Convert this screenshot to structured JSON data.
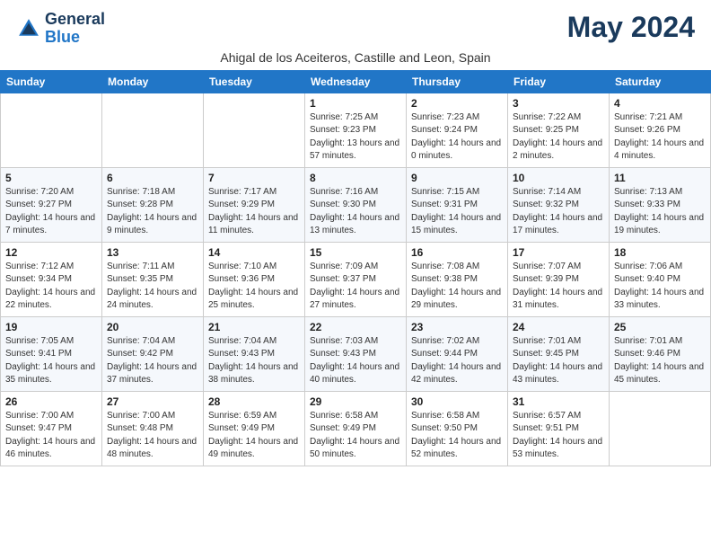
{
  "header": {
    "logo_line1": "General",
    "logo_line2": "Blue",
    "month": "May 2024",
    "subtitle": "Ahigal de los Aceiteros, Castille and Leon, Spain"
  },
  "days_of_week": [
    "Sunday",
    "Monday",
    "Tuesday",
    "Wednesday",
    "Thursday",
    "Friday",
    "Saturday"
  ],
  "weeks": [
    [
      {
        "day": "",
        "info": ""
      },
      {
        "day": "",
        "info": ""
      },
      {
        "day": "",
        "info": ""
      },
      {
        "day": "1",
        "info": "Sunrise: 7:25 AM\nSunset: 9:23 PM\nDaylight: 13 hours and 57 minutes."
      },
      {
        "day": "2",
        "info": "Sunrise: 7:23 AM\nSunset: 9:24 PM\nDaylight: 14 hours and 0 minutes."
      },
      {
        "day": "3",
        "info": "Sunrise: 7:22 AM\nSunset: 9:25 PM\nDaylight: 14 hours and 2 minutes."
      },
      {
        "day": "4",
        "info": "Sunrise: 7:21 AM\nSunset: 9:26 PM\nDaylight: 14 hours and 4 minutes."
      }
    ],
    [
      {
        "day": "5",
        "info": "Sunrise: 7:20 AM\nSunset: 9:27 PM\nDaylight: 14 hours and 7 minutes."
      },
      {
        "day": "6",
        "info": "Sunrise: 7:18 AM\nSunset: 9:28 PM\nDaylight: 14 hours and 9 minutes."
      },
      {
        "day": "7",
        "info": "Sunrise: 7:17 AM\nSunset: 9:29 PM\nDaylight: 14 hours and 11 minutes."
      },
      {
        "day": "8",
        "info": "Sunrise: 7:16 AM\nSunset: 9:30 PM\nDaylight: 14 hours and 13 minutes."
      },
      {
        "day": "9",
        "info": "Sunrise: 7:15 AM\nSunset: 9:31 PM\nDaylight: 14 hours and 15 minutes."
      },
      {
        "day": "10",
        "info": "Sunrise: 7:14 AM\nSunset: 9:32 PM\nDaylight: 14 hours and 17 minutes."
      },
      {
        "day": "11",
        "info": "Sunrise: 7:13 AM\nSunset: 9:33 PM\nDaylight: 14 hours and 19 minutes."
      }
    ],
    [
      {
        "day": "12",
        "info": "Sunrise: 7:12 AM\nSunset: 9:34 PM\nDaylight: 14 hours and 22 minutes."
      },
      {
        "day": "13",
        "info": "Sunrise: 7:11 AM\nSunset: 9:35 PM\nDaylight: 14 hours and 24 minutes."
      },
      {
        "day": "14",
        "info": "Sunrise: 7:10 AM\nSunset: 9:36 PM\nDaylight: 14 hours and 25 minutes."
      },
      {
        "day": "15",
        "info": "Sunrise: 7:09 AM\nSunset: 9:37 PM\nDaylight: 14 hours and 27 minutes."
      },
      {
        "day": "16",
        "info": "Sunrise: 7:08 AM\nSunset: 9:38 PM\nDaylight: 14 hours and 29 minutes."
      },
      {
        "day": "17",
        "info": "Sunrise: 7:07 AM\nSunset: 9:39 PM\nDaylight: 14 hours and 31 minutes."
      },
      {
        "day": "18",
        "info": "Sunrise: 7:06 AM\nSunset: 9:40 PM\nDaylight: 14 hours and 33 minutes."
      }
    ],
    [
      {
        "day": "19",
        "info": "Sunrise: 7:05 AM\nSunset: 9:41 PM\nDaylight: 14 hours and 35 minutes."
      },
      {
        "day": "20",
        "info": "Sunrise: 7:04 AM\nSunset: 9:42 PM\nDaylight: 14 hours and 37 minutes."
      },
      {
        "day": "21",
        "info": "Sunrise: 7:04 AM\nSunset: 9:43 PM\nDaylight: 14 hours and 38 minutes."
      },
      {
        "day": "22",
        "info": "Sunrise: 7:03 AM\nSunset: 9:43 PM\nDaylight: 14 hours and 40 minutes."
      },
      {
        "day": "23",
        "info": "Sunrise: 7:02 AM\nSunset: 9:44 PM\nDaylight: 14 hours and 42 minutes."
      },
      {
        "day": "24",
        "info": "Sunrise: 7:01 AM\nSunset: 9:45 PM\nDaylight: 14 hours and 43 minutes."
      },
      {
        "day": "25",
        "info": "Sunrise: 7:01 AM\nSunset: 9:46 PM\nDaylight: 14 hours and 45 minutes."
      }
    ],
    [
      {
        "day": "26",
        "info": "Sunrise: 7:00 AM\nSunset: 9:47 PM\nDaylight: 14 hours and 46 minutes."
      },
      {
        "day": "27",
        "info": "Sunrise: 7:00 AM\nSunset: 9:48 PM\nDaylight: 14 hours and 48 minutes."
      },
      {
        "day": "28",
        "info": "Sunrise: 6:59 AM\nSunset: 9:49 PM\nDaylight: 14 hours and 49 minutes."
      },
      {
        "day": "29",
        "info": "Sunrise: 6:58 AM\nSunset: 9:49 PM\nDaylight: 14 hours and 50 minutes."
      },
      {
        "day": "30",
        "info": "Sunrise: 6:58 AM\nSunset: 9:50 PM\nDaylight: 14 hours and 52 minutes."
      },
      {
        "day": "31",
        "info": "Sunrise: 6:57 AM\nSunset: 9:51 PM\nDaylight: 14 hours and 53 minutes."
      },
      {
        "day": "",
        "info": ""
      }
    ]
  ]
}
